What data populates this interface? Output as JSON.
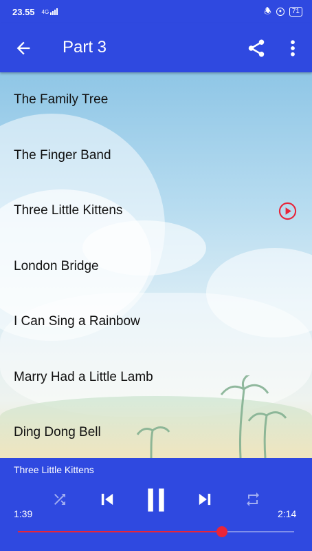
{
  "status_bar": {
    "time": "23.55",
    "network": "4G",
    "battery": "71"
  },
  "app_bar": {
    "title": "Part 3"
  },
  "songs": [
    {
      "title": "The Family Tree",
      "playing": false
    },
    {
      "title": "The Finger Band",
      "playing": false
    },
    {
      "title": "Three Little Kittens",
      "playing": true
    },
    {
      "title": "London Bridge",
      "playing": false
    },
    {
      "title": "I Can Sing a Rainbow",
      "playing": false
    },
    {
      "title": "Marry Had a Little Lamb",
      "playing": false
    },
    {
      "title": "Ding Dong Bell",
      "playing": false
    }
  ],
  "player": {
    "now_playing": "Three Little Kittens",
    "elapsed": "1:39",
    "total": "2:14",
    "progress": 0.74
  },
  "colors": {
    "primary": "#2f49e0",
    "accent": "#e8253a"
  }
}
